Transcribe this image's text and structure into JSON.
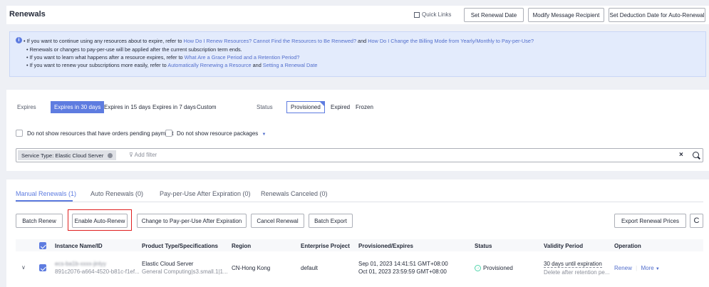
{
  "header": {
    "title": "Renewals",
    "quick_links": "Quick Links",
    "set_renewal_date": "Set Renewal Date",
    "modify_message_recipient": "Modify Message Recipient",
    "set_deduction_date": "Set Deduction Date for Auto-Renewal"
  },
  "notice": {
    "line1_prefix": "If you want to continue using any resources about to expire, refer to ",
    "line1_link1": "How Do I Renew Resources?",
    "line1_link2": "Cannot Find the Resources to Be Renewed?",
    "line1_and": " and ",
    "line1_link3": "How Do I Change the Billing Mode from Yearly/Monthly to Pay-per-Use?",
    "line2": "Renewals or changes to pay-per-use will be applied after the current subscription term ends.",
    "line3_prefix": "If you want to learn what happens after a resource expires, refer to ",
    "line3_link": "What Are a Grace Period and a Retention Period?",
    "line4_prefix": "If you want to renew your subscriptions more easily, refer to ",
    "line4_link1": "Automatically Renewing a Resource",
    "line4_and": " and ",
    "line4_link2": "Setting a Renewal Date"
  },
  "filters": {
    "expires_label": "Expires",
    "expires_options": [
      "Expires in 30 days",
      "Expires in 15 days",
      "Expires in 7 days",
      "Custom"
    ],
    "status_label": "Status",
    "status_options": [
      "Provisioned",
      "Expired",
      "Frozen"
    ],
    "check_pending": "Do not show resources that have orders pending payment",
    "check_packages": "Do not show resource packages",
    "service_tag": "Service Type: Elastic Cloud Server",
    "add_filter_placeholder": "Add filter"
  },
  "tabs": [
    "Manual Renewals (1)",
    "Auto Renewals (0)",
    "Pay-per-Use After Expiration (0)",
    "Renewals Canceled (0)"
  ],
  "actions": {
    "batch_renew": "Batch Renew",
    "enable_auto_renew": "Enable Auto-Renew",
    "change_ppu": "Change to Pay-per-Use After Expiration",
    "cancel_renewal": "Cancel Renewal",
    "batch_export": "Batch Export",
    "export_prices": "Export Renewal Prices"
  },
  "table": {
    "columns": [
      "Instance Name/ID",
      "Product Type/Specifications",
      "Region",
      "Enterprise Project",
      "Provisioned/Expires",
      "Status",
      "Validity Period",
      "Operation"
    ],
    "rows": [
      {
        "name": "ecs-ba1b-xxxx-jinlyy",
        "id": "891c2076-a664-4520-b81c-f1ef...",
        "product": "Elastic Cloud Server",
        "spec": "General Computing|s3.small.1|1...",
        "region": "CN-Hong Kong",
        "project": "default",
        "provisioned": "Sep 01, 2023 14:41:51 GMT+08:00",
        "expires": "Oct 01, 2023 23:59:59 GMT+08:00",
        "status": "Provisioned",
        "validity": "30 days until expiration",
        "validity_note": "Delete after retention pe...",
        "op_renew": "Renew",
        "op_more": "More"
      }
    ]
  },
  "colors": {
    "accent": "#5e7ce0",
    "link": "#526ecc",
    "success": "#50d4ab",
    "highlight_border": "#e02020"
  }
}
